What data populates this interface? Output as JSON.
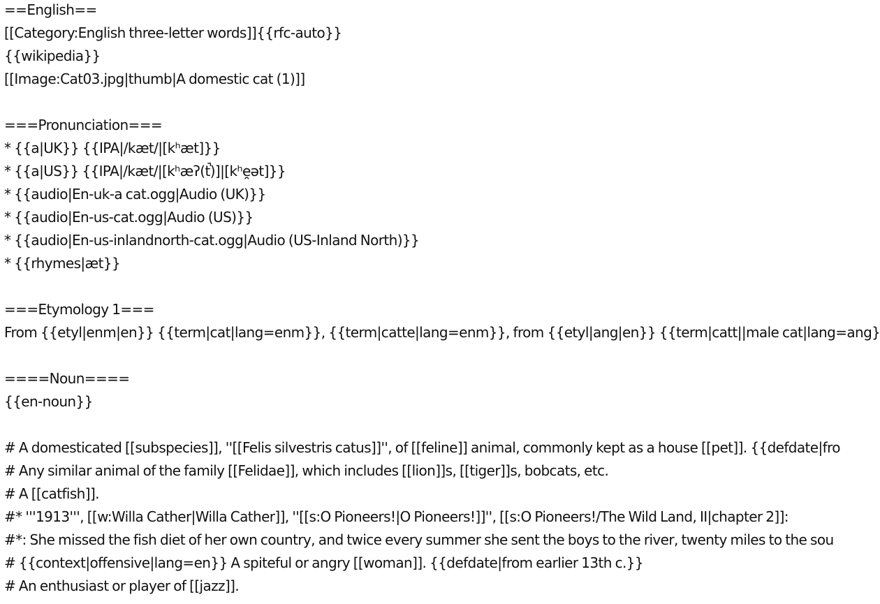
{
  "document": {
    "lines": [
      "==English==",
      "[[Category:English three-letter words]]{{rfc-auto}}",
      "{{wikipedia}}",
      "[[Image:Cat03.jpg|thumb|A domestic cat (1)]]",
      "",
      "===Pronunciation===",
      "* {{a|UK}} {{IPA|/kæt/|[kʰæt]}}",
      "* {{a|US}} {{IPA|/kæt/|[kʰæʔ(t̚)]|[kʰe̯ət]}}",
      "* {{audio|En-uk-a cat.ogg|Audio (UK)}}",
      "* {{audio|En-us-cat.ogg|Audio (US)}}",
      "* {{audio|En-us-inlandnorth-cat.ogg|Audio (US-Inland North)}}",
      "* {{rhymes|æt}}",
      "",
      "===Etymology 1===",
      "From {{etyl|enm|en}} {{term|cat|lang=enm}}, {{term|catte|lang=enm}}, from {{etyl|ang|en}} {{term|catt||male cat|lang=ang}} and",
      "",
      "====Noun====",
      "{{en-noun}}",
      "",
      "# A domesticated [[subspecies]], ''[[Felis silvestris catus]]'', of [[feline]] animal, commonly kept as a house [[pet]]. {{defdate|fro",
      "# Any similar animal of the family [[Felidae]], which includes [[lion]]s, [[tiger]]s, bobcats, etc.",
      "# A [[catfish]].",
      "#* '''1913''', [[w:Willa Cather|Willa Cather]], ''[[s:O Pioneers!|O Pioneers!]]'', [[s:O Pioneers!/The Wild Land, II|chapter 2]]:",
      "#*: She missed the fish diet of her own country, and twice every summer she sent the boys to the river, twenty miles to the sou",
      "# {{context|offensive|lang=en}} A spiteful or angry [[woman]]. {{defdate|from earlier 13th c.}}",
      "# An enthusiast or player of [[jazz]]."
    ]
  }
}
